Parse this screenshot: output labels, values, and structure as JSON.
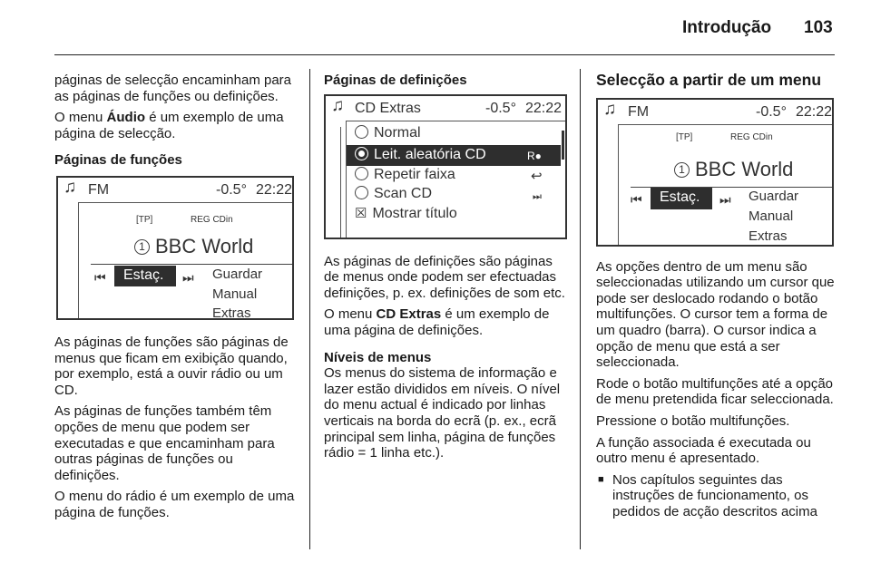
{
  "header": {
    "title": "Introdução",
    "page": "103"
  },
  "col1": {
    "p1": "páginas de selecção encaminham para as páginas de funções ou definições.",
    "p2_pre": "O menu ",
    "p2_bold": "Áudio",
    "p2_post": " é um exemplo de uma página de selecção.",
    "h1": "Páginas de funções",
    "p3": "As páginas de funções são páginas de menus que ficam em exibição quando, por exemplo, está a ouvir rádio ou um CD.",
    "p4": "As páginas de funções também têm opções de menu que podem ser executadas e que encaminham para outras páginas de funções ou definições.",
    "p5": "O menu do rádio é um exemplo de uma página de funções."
  },
  "screen_fm": {
    "source": "FM",
    "temp": "-0.5°",
    "time": "22:22",
    "tp": "[TP]",
    "reg": "REG",
    "cdin": "CDin",
    "preset": "1",
    "station": "BBC World",
    "selected": "Estaç.",
    "options": [
      "Guardar",
      "Manual",
      "Extras"
    ]
  },
  "col2": {
    "h1": "Páginas de definições",
    "p1": "As páginas de definições são páginas de menus onde podem ser efectuadas definições, p. ex. definições de som etc.",
    "p2_pre": "O menu ",
    "p2_bold": "CD Extras",
    "p2_post": " é um exemplo de uma página de definições.",
    "h2": "Níveis de menus",
    "p3": "Os menus do sistema de informação e lazer estão divididos em níveis. O nível do menu actual é indicado por linhas verticais na borda do ecrã (p. ex., ecrã principal sem linha, página de funções rádio = 1 linha etc.)."
  },
  "screen_cd": {
    "title": "CD Extras",
    "temp": "-0.5°",
    "time": "22:22",
    "items": [
      "Normal",
      "Leit. aleatória CD",
      "Repetir faixa",
      "Scan CD",
      "Mostrar título"
    ],
    "selected_index": 1
  },
  "col3": {
    "h1": "Selecção a partir de um menu",
    "p1": "As opções dentro de um menu são seleccionadas utilizando um cursor que pode ser deslocado rodando o botão multifunções. O cursor tem a forma de um quadro (barra). O cursor indica a opção de menu que está a ser seleccionada.",
    "p2": "Rode o botão multifunções até a opção de menu pretendida ficar seleccionada.",
    "p3": "Pressione o botão multifunções.",
    "p4": "A função associada é executada ou outro menu é apresentado.",
    "bullet1": "Nos capítulos seguintes das instruções de funcionamento, os pedidos de acção descritos acima"
  }
}
